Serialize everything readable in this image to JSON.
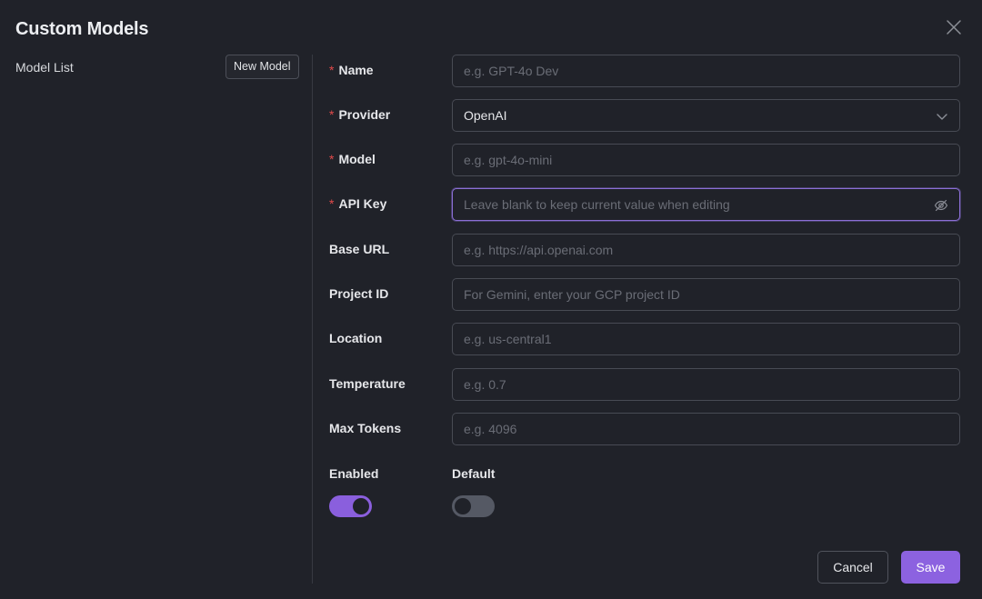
{
  "modal": {
    "title": "Custom Models"
  },
  "sidebar": {
    "label": "Model List",
    "new_button": "New Model"
  },
  "form": {
    "name": {
      "label": "Name",
      "required": "*",
      "placeholder": "e.g. GPT-4o Dev"
    },
    "provider": {
      "label": "Provider",
      "required": "*",
      "value": "OpenAI"
    },
    "model": {
      "label": "Model",
      "required": "*",
      "placeholder": "e.g. gpt-4o-mini"
    },
    "api_key": {
      "label": "API Key",
      "required": "*",
      "placeholder": "Leave blank to keep current value when editing"
    },
    "base_url": {
      "label": "Base URL",
      "placeholder": "e.g. https://api.openai.com"
    },
    "project_id": {
      "label": "Project ID",
      "placeholder": "For Gemini, enter your GCP project ID"
    },
    "location": {
      "label": "Location",
      "placeholder": "e.g. us-central1"
    },
    "temperature": {
      "label": "Temperature",
      "placeholder": "e.g. 0.7"
    },
    "max_tokens": {
      "label": "Max Tokens",
      "placeholder": "e.g. 4096"
    },
    "enabled": {
      "label": "Enabled",
      "state": "on"
    },
    "default": {
      "label": "Default",
      "state": "off"
    }
  },
  "actions": {
    "cancel": "Cancel",
    "save": "Save"
  },
  "colors": {
    "accent": "#8c62e0",
    "background": "#202229",
    "required": "#e24a4a",
    "focus": "#8b6fd6"
  },
  "icons": {
    "close": "close-icon",
    "select": "chevron-down-icon",
    "visibility": "eye-off-icon"
  }
}
